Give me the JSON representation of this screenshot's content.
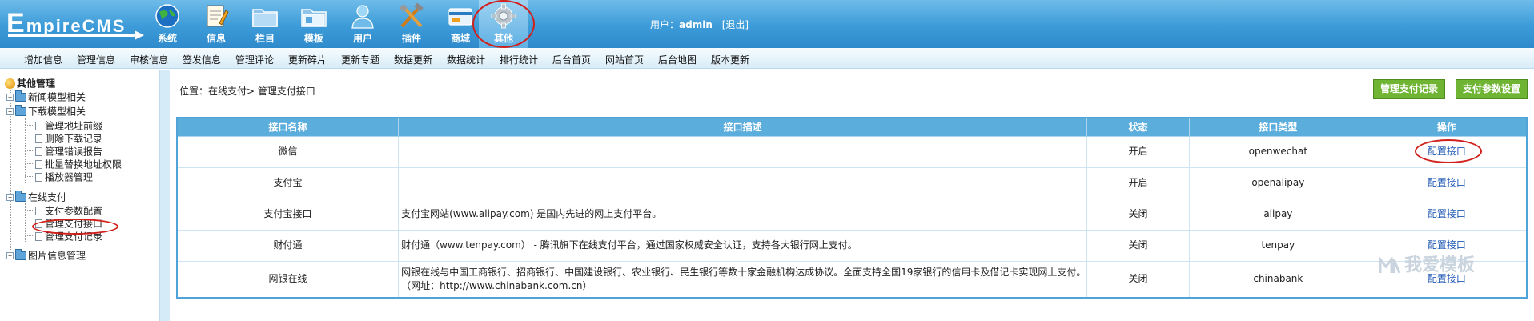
{
  "header": {
    "logo_text": "EmpireCMS",
    "nav": [
      {
        "label": "系统",
        "icon": "globe-icon"
      },
      {
        "label": "信息",
        "icon": "notepad-icon"
      },
      {
        "label": "栏目",
        "icon": "folder-icon"
      },
      {
        "label": "模板",
        "icon": "template-folder-icon"
      },
      {
        "label": "用户",
        "icon": "user-icon"
      },
      {
        "label": "插件",
        "icon": "tools-icon"
      },
      {
        "label": "商城",
        "icon": "shop-card-icon"
      },
      {
        "label": "其他",
        "icon": "gear-icon",
        "active": true
      }
    ],
    "user_label": "用户：",
    "username": "admin",
    "logout": "[退出]"
  },
  "submenu": [
    "增加信息",
    "管理信息",
    "审核信息",
    "签发信息",
    "管理评论",
    "更新碎片",
    "更新专题",
    "数据更新",
    "数据统计",
    "排行统计",
    "后台首页",
    "网站首页",
    "后台地图",
    "版本更新"
  ],
  "sidebar": {
    "root": "其他管理",
    "groups": [
      {
        "label": "新闻模型相关",
        "expanded": false
      },
      {
        "label": "下载模型相关",
        "expanded": true,
        "items": [
          "管理地址前缀",
          "删除下载记录",
          "管理错误报告",
          "批量替换地址权限",
          "播放器管理"
        ]
      },
      {
        "label": "在线支付",
        "expanded": true,
        "items": [
          "支付参数配置",
          "管理支付接口",
          "管理支付记录"
        ]
      },
      {
        "label": "图片信息管理",
        "expanded": false
      }
    ]
  },
  "breadcrumb": "位置：在线支付> 管理支付接口",
  "buttons": {
    "records": "管理支付记录",
    "settings": "支付参数设置"
  },
  "table": {
    "headers": [
      "接口名称",
      "接口描述",
      "状态",
      "接口类型",
      "操作"
    ],
    "action_label": "配置接口",
    "rows": [
      {
        "name": "微信",
        "desc": "",
        "status": "开启",
        "type": "openwechat"
      },
      {
        "name": "支付宝",
        "desc": "",
        "status": "开启",
        "type": "openalipay"
      },
      {
        "name": "支付宝接口",
        "desc": "支付宝网站(www.alipay.com) 是国内先进的网上支付平台。",
        "status": "关闭",
        "type": "alipay"
      },
      {
        "name": "财付通",
        "desc": "财付通（www.tenpay.com） - 腾讯旗下在线支付平台，通过国家权威安全认证，支持各大银行网上支付。",
        "status": "关闭",
        "type": "tenpay"
      },
      {
        "name": "网银在线",
        "desc": "网银在线与中国工商银行、招商银行、中国建设银行、农业银行、民生银行等数十家金融机构达成协议。全面支持全国19家银行的信用卡及借记卡实现网上支付。",
        "desc2": "（网址：http://www.chinabank.com.cn）",
        "status": "关闭",
        "type": "chinabank"
      }
    ]
  },
  "watermark": "我爱模板",
  "colors": {
    "header": "#3c9bd8",
    "table_header": "#5baddc",
    "button_green": "#6fb533",
    "highlight_circle": "#d0211c"
  }
}
